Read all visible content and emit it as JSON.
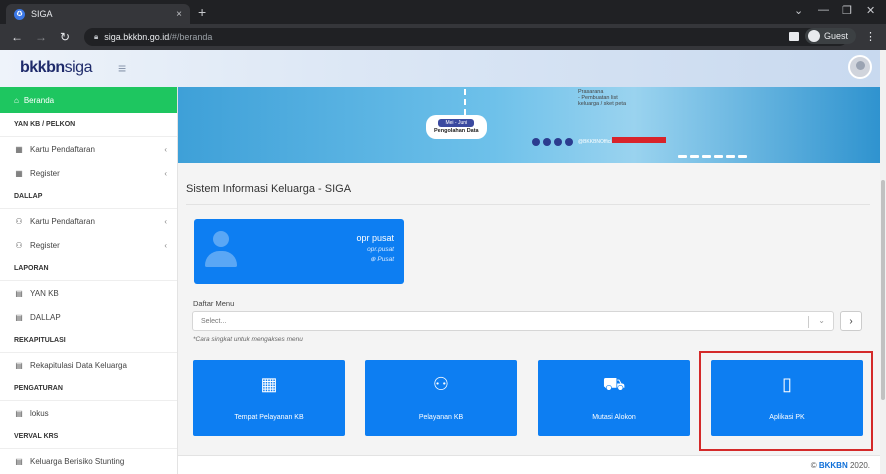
{
  "browser": {
    "tab_title": "SIGA",
    "tab_close": "×",
    "new_tab": "+",
    "url_host": "siga.bkkbn.go.id",
    "url_path": "/#/beranda",
    "profile_label": "Guest",
    "win_minimize": "—",
    "win_restore": "❐",
    "win_close": "✕",
    "win_tabsearch": "⌄"
  },
  "header": {
    "logo_main": "bkkbn",
    "logo_sub": "siga"
  },
  "sidebar": {
    "active_item": "Beranda",
    "sections": [
      {
        "title": "YAN KB / PELKON",
        "items": [
          {
            "label": "Kartu Pendaftaran",
            "chev": "‹"
          },
          {
            "label": "Register",
            "chev": "‹"
          }
        ]
      },
      {
        "title": "DALLAP",
        "items": [
          {
            "label": "Kartu Pendaftaran",
            "chev": "‹"
          },
          {
            "label": "Register",
            "chev": "‹"
          }
        ]
      },
      {
        "title": "LAPORAN",
        "items": [
          {
            "label": "YAN KB"
          },
          {
            "label": "DALLAP"
          }
        ]
      },
      {
        "title": "REKAPITULASI",
        "items": [
          {
            "label": "Rekapitulasi Data Keluarga"
          }
        ]
      },
      {
        "title": "PENGATURAN",
        "items": [
          {
            "label": "lokus"
          }
        ]
      },
      {
        "title": "VERVAL KRS",
        "items": [
          {
            "label": "Keluarga Berisiko Stunting"
          }
        ]
      }
    ]
  },
  "banner": {
    "prasarana_lines": [
      "Prasarana",
      "- Pembuatan list",
      "keluarga / sket peta"
    ],
    "pill_tag": "Mei - Juni",
    "pill_text": "Pengolahan Data",
    "social_handle": "@BKKBNOfficial"
  },
  "main": {
    "page_title": "Sistem Informasi Keluarga - SIGA",
    "user": {
      "name": "opr pusat",
      "username": "opr.pusat",
      "level": "Pusat",
      "level_icon": "⊕"
    },
    "menu_label": "Daftar Menu",
    "menu_placeholder": "Select...",
    "menu_caret": "⌄",
    "go_label": "›",
    "menu_hint": "*Cara singkat untuk mengakses menu",
    "tiles": [
      {
        "label": "Tempat Pelayanan KB",
        "icon": "building-icon"
      },
      {
        "label": "Pelayanan KB",
        "icon": "people-icon"
      },
      {
        "label": "Mutasi Alokon",
        "icon": "truck-icon"
      },
      {
        "label": "Aplikasi PK",
        "icon": "mobile-icon"
      }
    ]
  },
  "footer": {
    "prefix": "©",
    "brand": "BKKBN",
    "year": "2020."
  }
}
